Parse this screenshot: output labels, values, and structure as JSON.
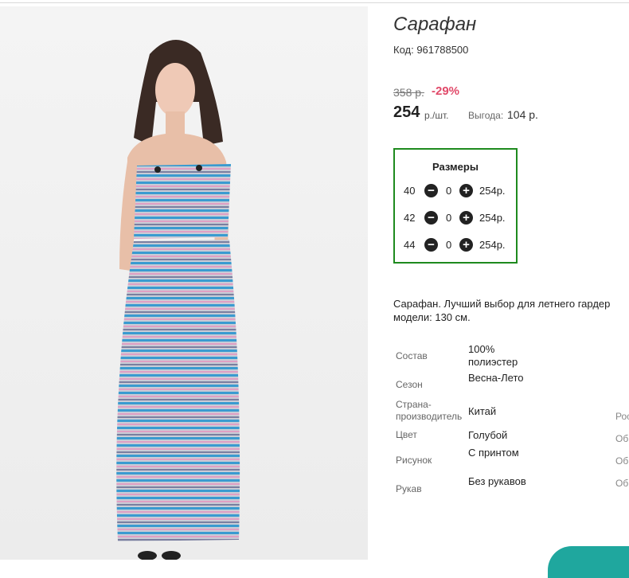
{
  "product": {
    "title": "Сарафан",
    "code": "Код: 961788500",
    "old_price": "358 р.",
    "discount": "-29%",
    "price": "254",
    "price_unit": "р./шт.",
    "savings_label": "Выгода:",
    "savings_value": "104 р."
  },
  "sizes": {
    "title": "Размеры",
    "rows": [
      {
        "size": "40",
        "qty": "0",
        "price": "254р."
      },
      {
        "size": "42",
        "qty": "0",
        "price": "254р."
      },
      {
        "size": "44",
        "qty": "0",
        "price": "254р."
      }
    ]
  },
  "description": {
    "line1": "Сарафан. Лучший выбор для летнего гардер",
    "line2": "модели: 130 см."
  },
  "properties": [
    {
      "label": "Состав",
      "value": "100% полиэстер"
    },
    {
      "label": "Сезон",
      "value": "Весна-Лето"
    },
    {
      "label": "Страна-производитель",
      "value": "Китай"
    },
    {
      "label": "Цвет",
      "value": "Голубой"
    },
    {
      "label": "Рисунок",
      "value": "С принтом"
    },
    {
      "label": "Рукав",
      "value": "Без рукавов"
    }
  ],
  "cut_column": [
    "Рос",
    "Об",
    "Об",
    "Об"
  ],
  "colors": {
    "discount": "#e14a6a",
    "sizes_border": "#1e8a1e",
    "dress_blue": "#3a9bd0",
    "dress_pink": "#e0a0c4",
    "corner_accent": "#1fa79e"
  },
  "icons": {
    "minus": "minus-circle-icon",
    "plus": "plus-circle-icon"
  }
}
